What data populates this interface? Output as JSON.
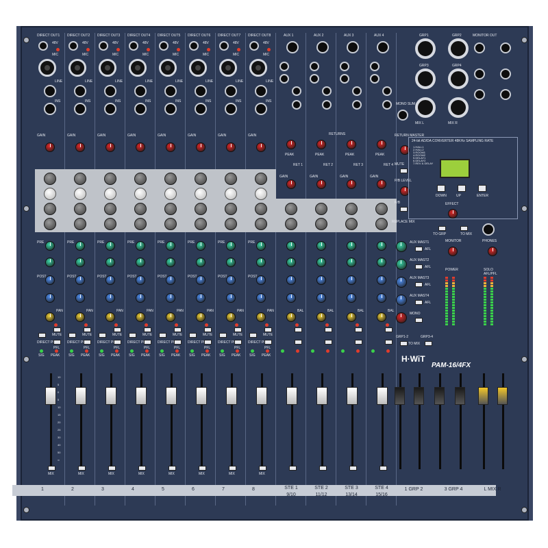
{
  "mixer": {
    "brand": "H·WiT",
    "model": "PAM-16/4FX",
    "colors": {
      "panel": "#2d3a55",
      "eq_band": "#bfc3c9",
      "label_bar": "#c7ccd5",
      "lcd": "#9ccf3c"
    }
  },
  "mono_channels": [
    {
      "direct_out": "DIRECT OUT1",
      "label": "1"
    },
    {
      "direct_out": "DIRECT OUT2",
      "label": "2"
    },
    {
      "direct_out": "DIRECT OUT3",
      "label": "3"
    },
    {
      "direct_out": "DIRECT OUT4",
      "label": "4"
    },
    {
      "direct_out": "DIRECT OUT5",
      "label": "5"
    },
    {
      "direct_out": "DIRECT OUT6",
      "label": "6"
    },
    {
      "direct_out": "DIRECT OUT7",
      "label": "7"
    },
    {
      "direct_out": "DIRECT OUT8",
      "label": "8"
    }
  ],
  "stereo_channels": [
    {
      "aux": "AUX 1",
      "label": "STE 1",
      "sub": "9/10"
    },
    {
      "aux": "AUX 2",
      "label": "STE 2",
      "sub": "11/12"
    },
    {
      "aux": "AUX 3",
      "label": "STE 3",
      "sub": "13/14"
    },
    {
      "aux": "AUX 4",
      "label": "STE 4",
      "sub": "15/16"
    }
  ],
  "channel_text": {
    "p48": "48V",
    "mic": "MIC",
    "line": "LINE",
    "ins": "INS",
    "gain": "GAIN",
    "mute": "MUTE",
    "pfl": "PFL",
    "sig": "SIG",
    "peak": "PEAK",
    "mix": "MIX",
    "direct_pre": "DIRECT PRE",
    "pre": "PRE",
    "post": "POST",
    "pan": "PAN",
    "bal": "BAL",
    "eff": "EFF"
  },
  "returns": {
    "gain": "GAIN",
    "returns": "RETURNS",
    "peak": "PEAK",
    "ret_labels": [
      "RET 1",
      "RET 2",
      "RET 3",
      "RET 4"
    ],
    "return_master": "RETURN MASTER"
  },
  "master": {
    "monitor_out": "MONITOR OUT",
    "grp_labels": [
      "GRP1",
      "GRP2",
      "GRP3",
      "GRP4"
    ],
    "mix_l": "MIX L",
    "mix_r": "MIX R",
    "mono_sum": "MONO SUM",
    "fx_header": "24-bit AD/DA CONVERTER 48KHz SAMPLING RATE",
    "fx_presets": [
      "1.HALL1",
      "2.HALL2",
      "3.ROOM1",
      "4.ROOM2",
      "5.DELAY1",
      "6.DELAY2",
      "7.REV & DELAY"
    ],
    "fx_buttons": [
      "DOWN",
      "UP",
      "ENTER"
    ],
    "effect": "EFFECT",
    "to_grp": "TO GRP",
    "to_mix": "TO MIX",
    "monitor": "MONITOR",
    "phones": "PHONES",
    "power": "POWER",
    "solo": "SOLO",
    "afl_pfl": "AFL/PFL",
    "aux_masters": [
      "AUX MAST1",
      "AUX MAST2",
      "AUX MAST3",
      "AUX MAST4"
    ],
    "afl": "AFL",
    "mono": "MONO",
    "grp12": "GRP1-2",
    "grp34": "GRP3-4",
    "to_mix_btn": "TO MIX",
    "pb_level": "P/B LEVEL",
    "pb": "P/B",
    "replace_mix": "REPLACE MIX"
  },
  "fader_groups": [
    {
      "label": "1 GRP 2"
    },
    {
      "label": "3 GRP 4"
    },
    {
      "label": "L MIX R"
    }
  ],
  "fader_scale": [
    "10",
    "5",
    "0",
    "5",
    "10",
    "15",
    "20",
    "25",
    "30",
    "40",
    "50",
    "∞"
  ]
}
